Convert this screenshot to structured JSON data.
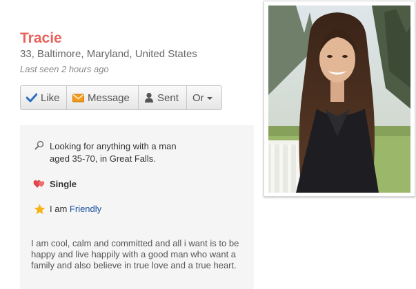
{
  "profile": {
    "name": "Tracie",
    "location": "33, Baltimore, Maryland, United States",
    "last_seen": "Last seen 2 hours ago"
  },
  "actions": {
    "like": "Like",
    "message": "Message",
    "sent": "Sent",
    "or": "Or"
  },
  "details": {
    "looking_line1": "Looking for anything with a man",
    "looking_line2": "aged 35-70, in Great Falls.",
    "status": "Single",
    "i_am_prefix": "I am",
    "i_am_value": "Friendly",
    "about": "I am cool, calm and committed and all i want is to be happy and live happily with a good man who want a family and also believe in true love and a true heart."
  },
  "icons": {
    "like": "check-icon",
    "message": "envelope-icon",
    "sent": "person-icon",
    "looking": "search-icon",
    "status": "hearts-icon",
    "personality": "star-icon"
  },
  "colors": {
    "name": "#e8625c",
    "link": "#1a4fa0",
    "heart": "#e0474c",
    "star": "#f5b315",
    "check": "#2a6fc2"
  }
}
